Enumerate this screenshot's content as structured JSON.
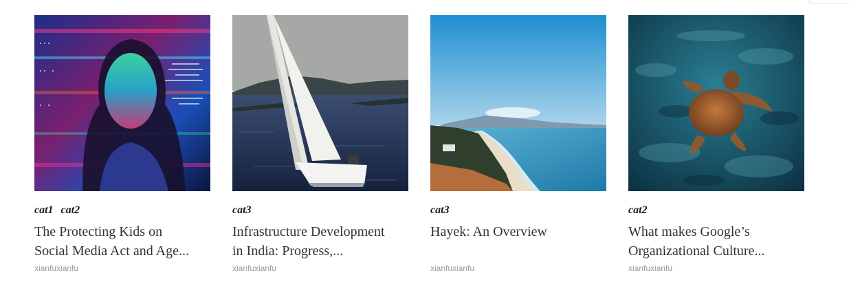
{
  "articles": [
    {
      "image": "woman-with-code-projection",
      "categories": [
        "cat1",
        "cat2"
      ],
      "title_line1": "The Protecting Kids on",
      "title_line2": "Social Media Act and Age...",
      "author": "xianfuxianfu"
    },
    {
      "image": "sailboat-on-sea",
      "categories": [
        "cat3"
      ],
      "title_line1": "Infrastructure Development",
      "title_line2": "in India: Progress,...",
      "author": "xianfuxianfu"
    },
    {
      "image": "coastal-beach-view",
      "categories": [
        "cat3"
      ],
      "title_line1": "Hayek: An Overview",
      "title_line2": "",
      "author": "xianfuxianfu"
    },
    {
      "image": "sea-turtle-underwater",
      "categories": [
        "cat2"
      ],
      "title_line1": "What makes Google’s",
      "title_line2": "Organizational Culture...",
      "author": "xianfuxianfu"
    }
  ]
}
